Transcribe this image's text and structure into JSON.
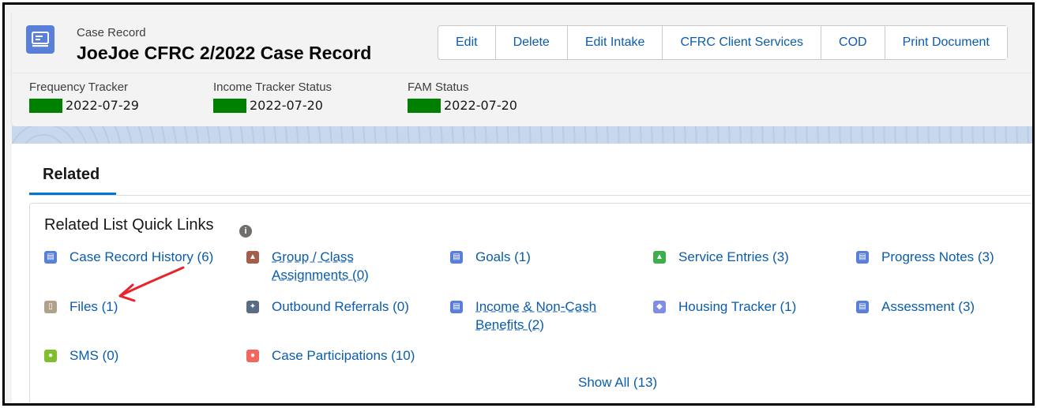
{
  "header": {
    "object_type": "Case Record",
    "title": "JoeJoe CFRC 2/2022 Case Record",
    "buttons": [
      "Edit",
      "Delete",
      "Edit Intake",
      "CFRC Client Services",
      "COD",
      "Print Document"
    ]
  },
  "fields": [
    {
      "label": "Frequency Tracker",
      "value": "2022-07-29",
      "status_color": "#008000"
    },
    {
      "label": "Income Tracker Status",
      "value": "2022-07-20",
      "status_color": "#008000"
    },
    {
      "label": "FAM Status",
      "value": "2022-07-20",
      "status_color": "#008000"
    }
  ],
  "tabs": [
    {
      "label": "Related",
      "active": true
    }
  ],
  "quick_links": {
    "title": "Related List Quick Links",
    "items": [
      {
        "label": "Case Record History (6)",
        "icon": "record-icon",
        "color": "#5a7fd8"
      },
      {
        "label": "Group / Class Assignments (0)",
        "icon": "shield-icon",
        "color": "#a45d4a"
      },
      {
        "label": "Goals (1)",
        "icon": "record-icon",
        "color": "#5a7fd8"
      },
      {
        "label": "Service Entries (3)",
        "icon": "service-icon",
        "color": "#3cae4a"
      },
      {
        "label": "Progress Notes (3)",
        "icon": "record-icon",
        "color": "#5a7fd8"
      },
      {
        "label": "Files (1)",
        "icon": "files-icon",
        "color": "#b0a28a"
      },
      {
        "label": "Outbound Referrals (0)",
        "icon": "wrench-icon",
        "color": "#5a6b84"
      },
      {
        "label": "Income & Non-Cash Benefits (2)",
        "icon": "record-icon",
        "color": "#5a7fd8"
      },
      {
        "label": "Housing Tracker (1)",
        "icon": "diamond-icon",
        "color": "#7f8ce8"
      },
      {
        "label": "Assessment (3)",
        "icon": "record-icon",
        "color": "#5a7fd8"
      },
      {
        "label": "SMS (0)",
        "icon": "sms-icon",
        "color": "#7fbe2c"
      },
      {
        "label": "Case Participations (10)",
        "icon": "participants-icon",
        "color": "#f2675c"
      }
    ],
    "show_all": "Show All (13)"
  },
  "annotation": {
    "arrow_color": "#e8242a"
  }
}
